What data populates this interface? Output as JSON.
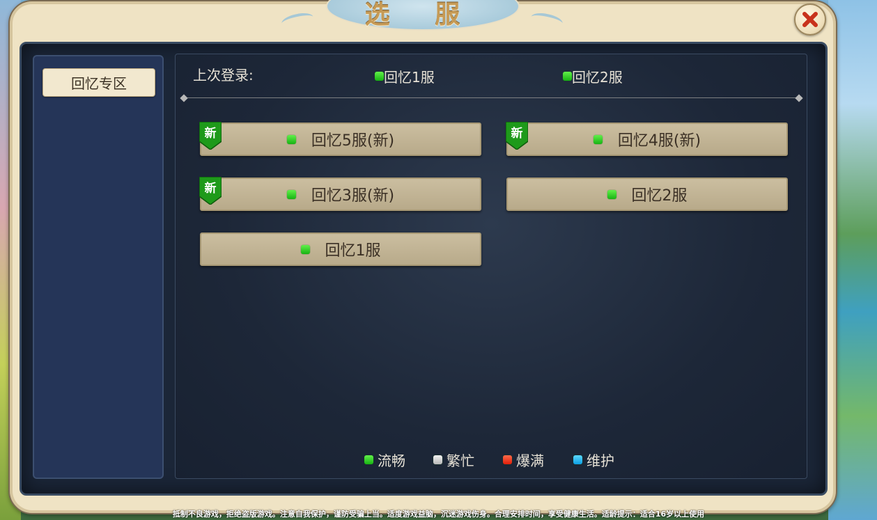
{
  "window": {
    "title": "选 服"
  },
  "sidebar": {
    "tabs": [
      {
        "label": "回忆专区"
      }
    ]
  },
  "last_login": {
    "label": "上次登录:",
    "servers": [
      {
        "name": "回忆1服",
        "status": "流畅"
      },
      {
        "name": "回忆2服",
        "status": "流畅"
      }
    ]
  },
  "servers": [
    {
      "name": "回忆5服(新)",
      "status": "流畅",
      "new_badge": "新"
    },
    {
      "name": "回忆4服(新)",
      "status": "流畅",
      "new_badge": "新"
    },
    {
      "name": "回忆3服(新)",
      "status": "流畅",
      "new_badge": "新"
    },
    {
      "name": "回忆2服",
      "status": "流畅"
    },
    {
      "name": "回忆1服",
      "status": "流畅"
    }
  ],
  "legend": [
    {
      "label": "流畅",
      "color": "#17b313"
    },
    {
      "label": "繁忙",
      "color": "#b8b8b8"
    },
    {
      "label": "爆满",
      "color": "#e01e0a"
    },
    {
      "label": "维护",
      "color": "#0d9fe3"
    }
  ],
  "footer": {
    "notice": "抵制不良游戏，拒绝盗版游戏。注意自我保护，谨防受骗上当。适度游戏益脑，沉迷游戏伤身。合理安排时间，享受健康生活。适龄提示：适合16岁以上使用"
  },
  "icons": {
    "close": "close-icon",
    "new": "new-badge-icon",
    "status": "status-dot-icon"
  }
}
